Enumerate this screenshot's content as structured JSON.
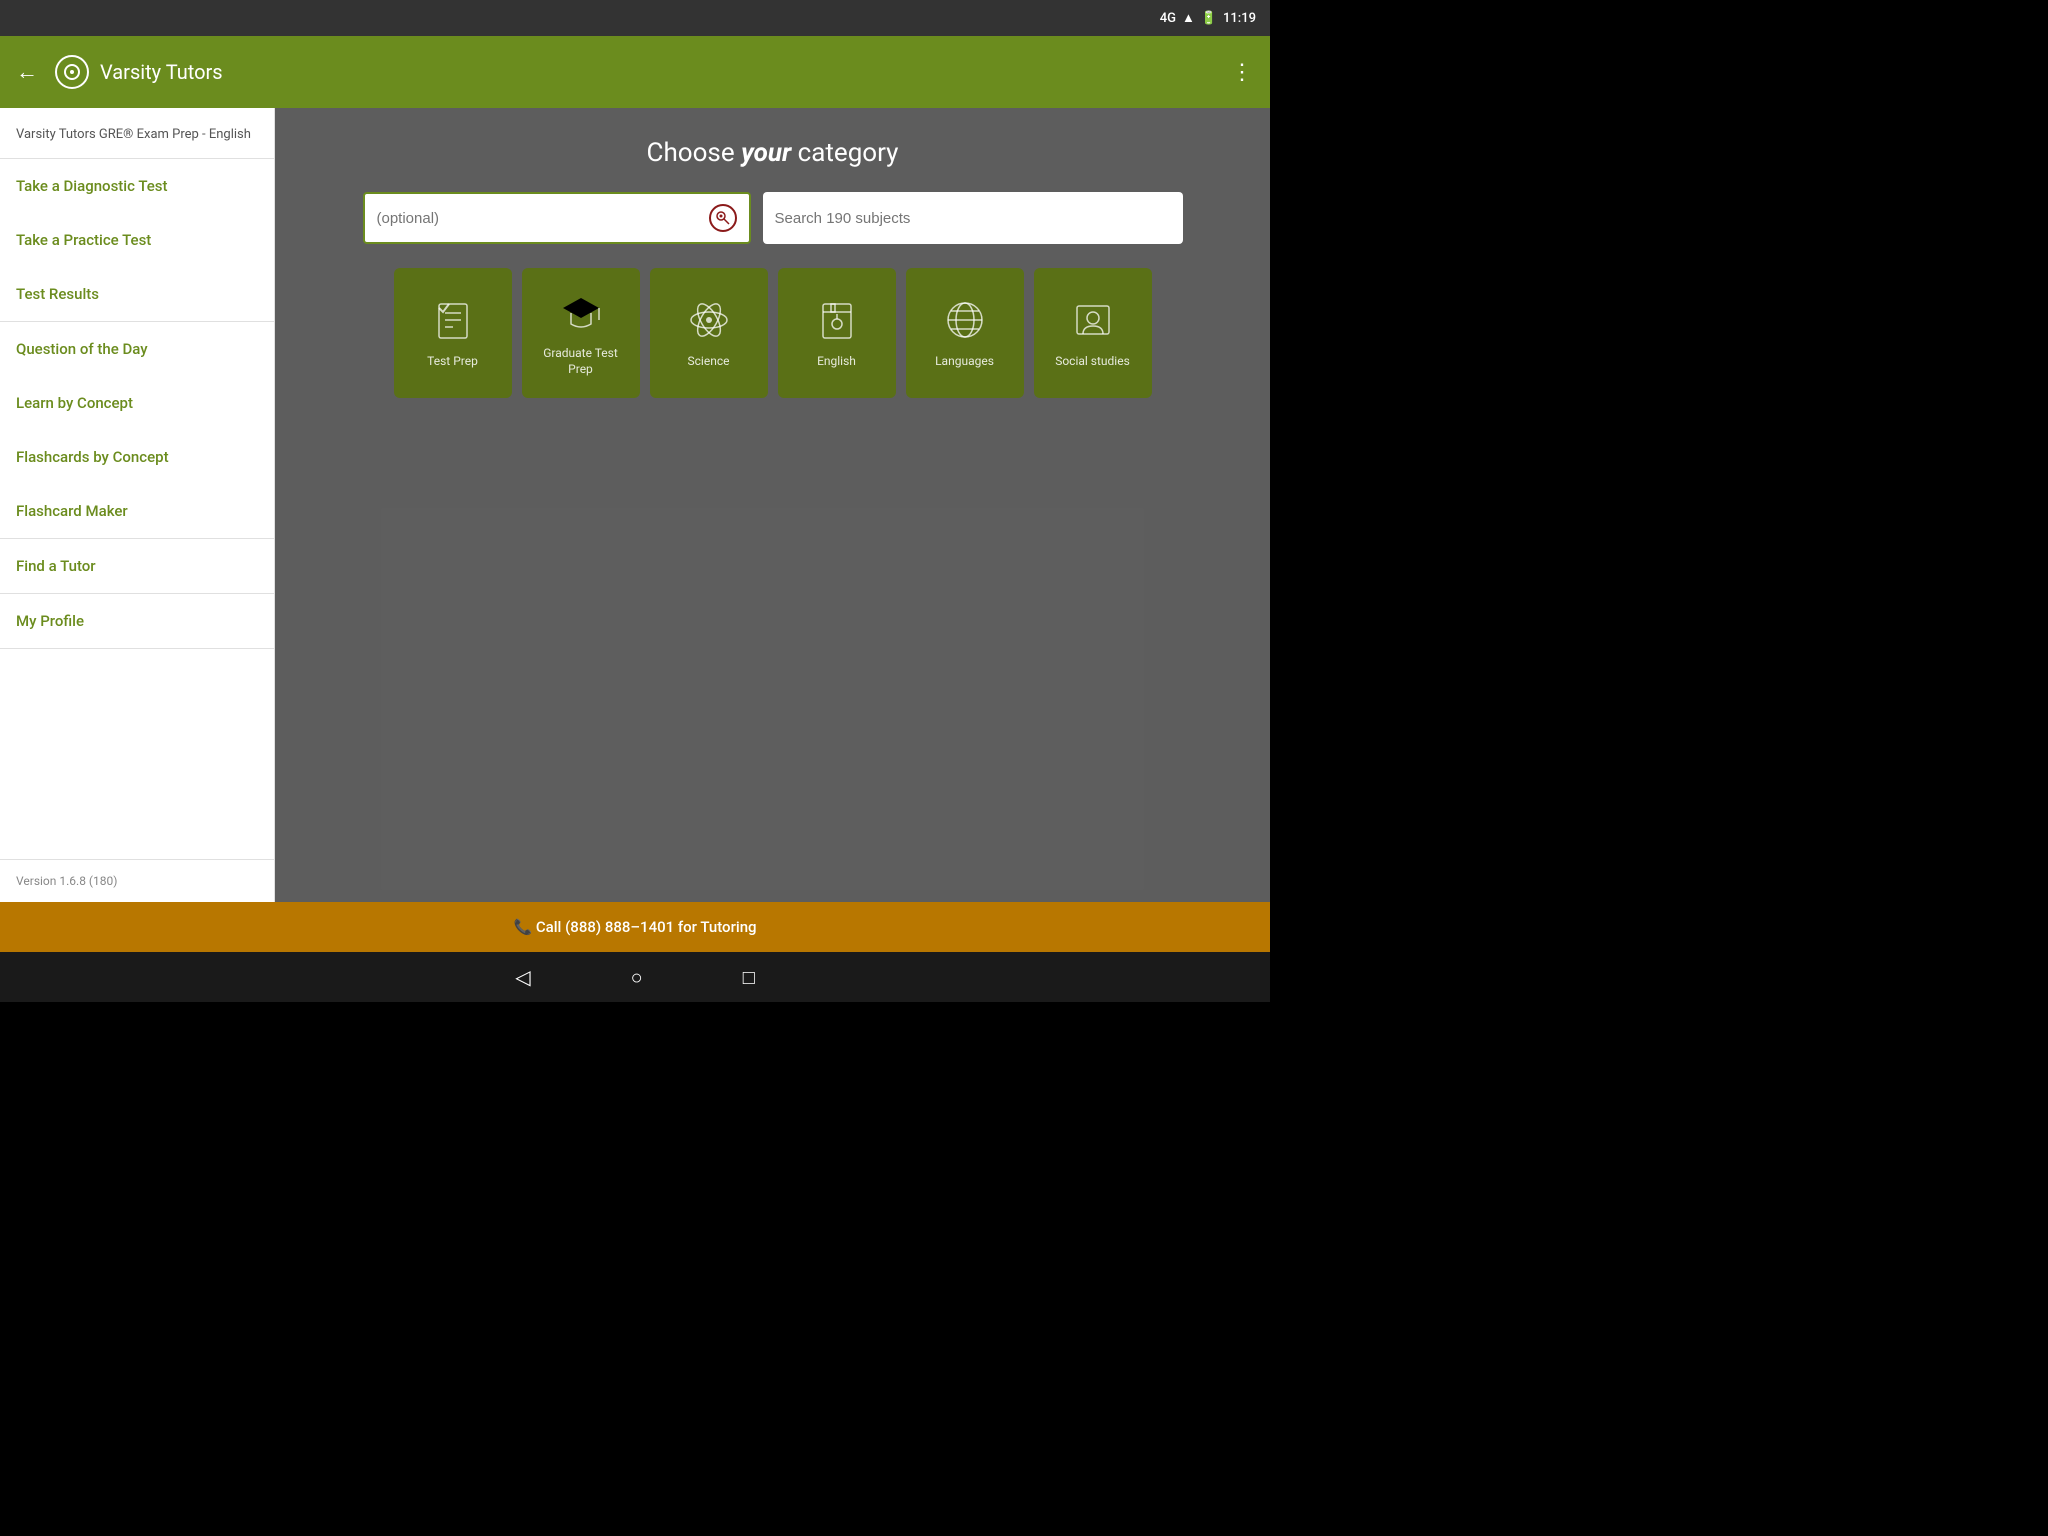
{
  "statusBar": {
    "network": "4G",
    "time": "11:19",
    "battery_icon": "🔋"
  },
  "appBar": {
    "title": "Varsity Tutors",
    "back_label": "←",
    "menu_label": "⋮"
  },
  "sidebar": {
    "header": "Varsity Tutors GRE® Exam Prep - English",
    "items": [
      {
        "label": "Take a Diagnostic Test",
        "key": "diagnostic"
      },
      {
        "label": "Take a Practice Test",
        "key": "practice"
      },
      {
        "label": "Test Results",
        "key": "results"
      },
      {
        "label": "Question of the Day",
        "key": "qod"
      },
      {
        "label": "Learn by Concept",
        "key": "learn"
      },
      {
        "label": "Flashcards by Concept",
        "key": "flashcards"
      },
      {
        "label": "Flashcard Maker",
        "key": "maker"
      },
      {
        "label": "Find a Tutor",
        "key": "tutor"
      },
      {
        "label": "My Profile",
        "key": "profile"
      }
    ],
    "version": "Version 1.6.8 (180)"
  },
  "content": {
    "title_plain": "Choose ",
    "title_italic": "your",
    "title_suffix": " category",
    "search_filter_placeholder": "(optional)",
    "search_subject_placeholder": "Search 190 subjects",
    "categories": [
      {
        "label": "Test Prep",
        "icon": "checklist"
      },
      {
        "label": "Graduate Test Prep",
        "icon": "graduation"
      },
      {
        "label": "Science",
        "icon": "atom"
      },
      {
        "label": "English",
        "icon": "book"
      },
      {
        "label": "Languages",
        "icon": "globe"
      },
      {
        "label": "Social studies",
        "icon": "person-card"
      }
    ]
  },
  "callBar": {
    "text": "📞  Call (888) 888–1401 for Tutoring"
  },
  "navBar": {
    "back": "◁",
    "home": "○",
    "recent": "□"
  }
}
